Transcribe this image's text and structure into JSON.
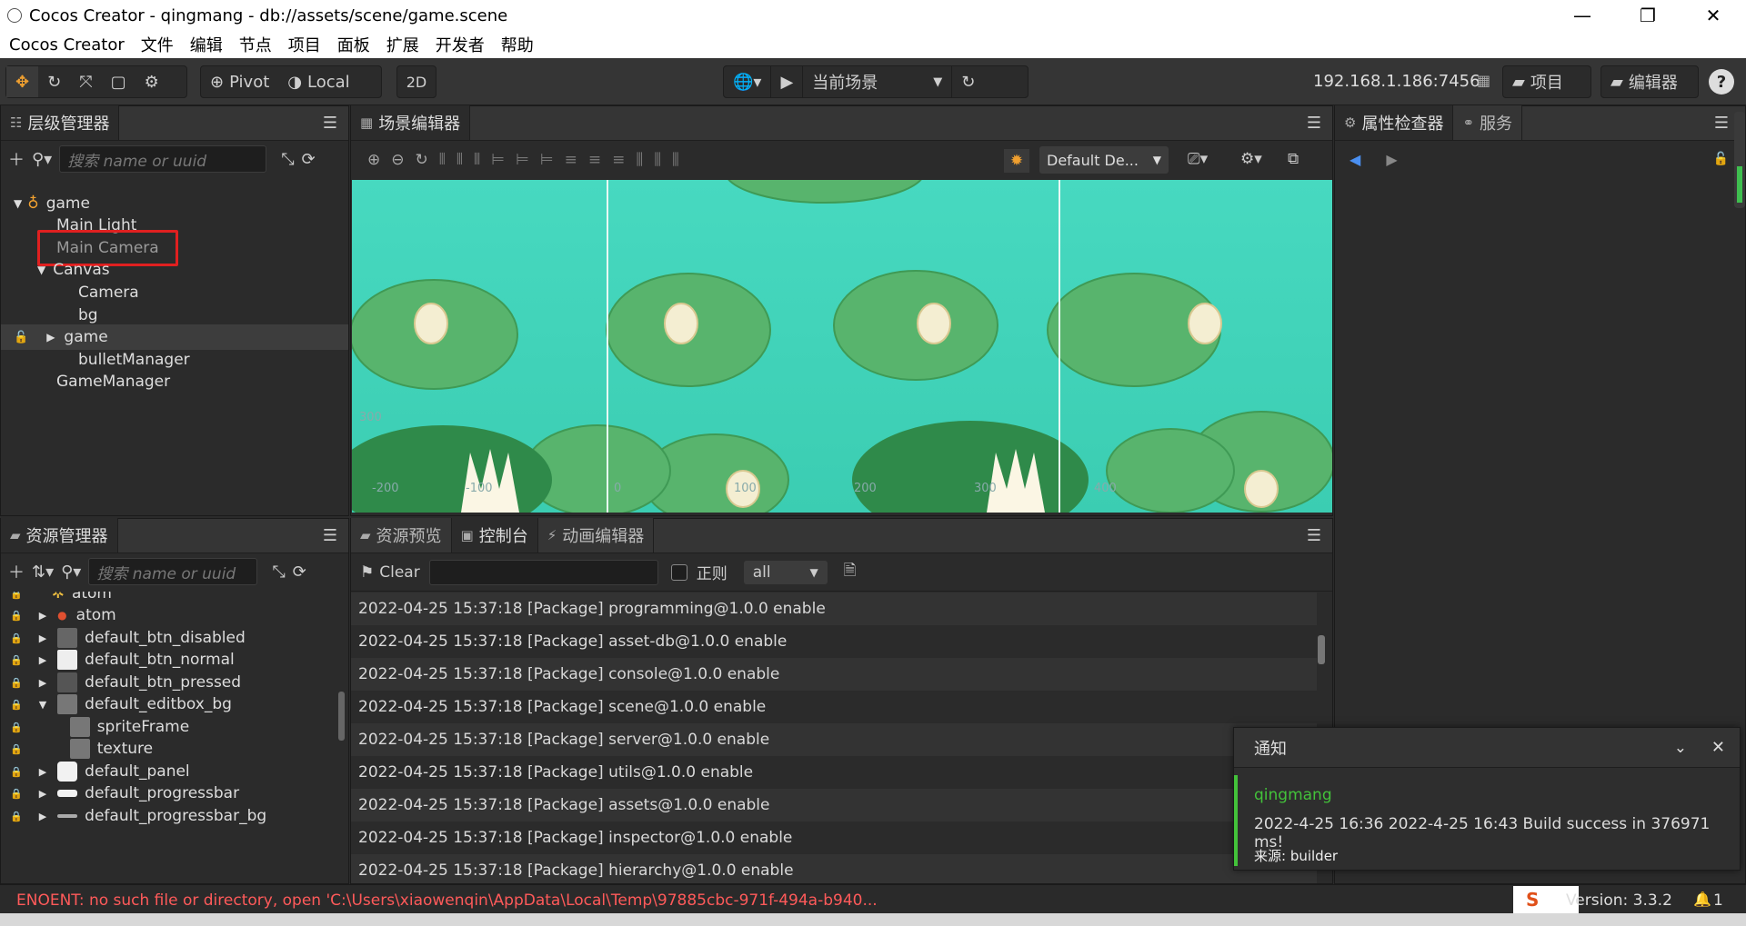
{
  "window": {
    "title": "Cocos Creator - qingmang - db://assets/scene/game.scene",
    "minimize": "—",
    "maximize": "❐",
    "close": "✕"
  },
  "menu": [
    "Cocos Creator",
    "文件",
    "编辑",
    "节点",
    "项目",
    "面板",
    "扩展",
    "开发者",
    "帮助"
  ],
  "toolbar": {
    "pivot": "Pivot",
    "local": "Local",
    "mode2d": "2D",
    "scene_select": "当前场景",
    "ip": "192.168.1.186:7456",
    "project_btn": "项目",
    "editor_btn": "编辑器",
    "help": "?"
  },
  "hierarchy": {
    "tab": "层级管理器",
    "search_placeholder": "搜索 name or uuid",
    "items": [
      "game",
      "Main Light",
      "Main Camera",
      "Canvas",
      "Camera",
      "bg",
      "game",
      "bulletManager",
      "GameManager"
    ]
  },
  "scene_editor": {
    "tab": "场景编辑器",
    "design_resolution": "Default De...",
    "axis_labels": [
      "300",
      "-200",
      "-100",
      "0",
      "100",
      "200",
      "300",
      "400"
    ]
  },
  "inspector": {
    "tab_properties": "属性检查器",
    "tab_services": "服务"
  },
  "assets": {
    "tab": "资源管理器",
    "search_placeholder": "搜索 name or uuid",
    "items": [
      "atom",
      "atom",
      "default_btn_disabled",
      "default_btn_normal",
      "default_btn_pressed",
      "default_editbox_bg",
      "spriteFrame",
      "texture",
      "default_panel",
      "default_progressbar",
      "default_progressbar_bg"
    ]
  },
  "console": {
    "tabs": [
      "资源预览",
      "控制台",
      "动画编辑器"
    ],
    "clear": "Clear",
    "regex_label": "正则",
    "filter": "all",
    "logs": [
      "2022-04-25 15:37:18 [Package] programming@1.0.0 enable",
      "2022-04-25 15:37:18 [Package] asset-db@1.0.0 enable",
      "2022-04-25 15:37:18 [Package] console@1.0.0 enable",
      "2022-04-25 15:37:18 [Package] scene@1.0.0 enable",
      "2022-04-25 15:37:18 [Package] server@1.0.0 enable",
      "2022-04-25 15:37:18 [Package] utils@1.0.0 enable",
      "2022-04-25 15:37:18 [Package] assets@1.0.0 enable",
      "2022-04-25 15:37:18 [Package] inspector@1.0.0 enable",
      "2022-04-25 15:37:18 [Package] hierarchy@1.0.0 enable"
    ]
  },
  "notification": {
    "title": "通知",
    "project": "qingmang",
    "message": "2022-4-25 16:36 2022-4-25 16:43 Build success in 376971 ms!",
    "source": "来源: builder"
  },
  "status": {
    "error": "ENOENT: no such file or directory, open 'C:\\Users\\xiaowenqin\\AppData\\Local\\Temp\\97885cbc-971f-494a-b940...",
    "version": "Version: 3.3.2",
    "notif_count": "1"
  },
  "colors": {
    "accent_orange": "#f0a030",
    "error_red": "#ff5a5a",
    "success_green": "#43c23a",
    "highlight_box": "#e02020"
  }
}
